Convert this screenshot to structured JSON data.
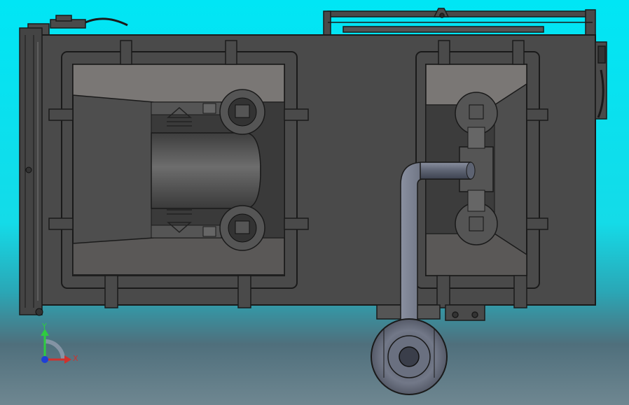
{
  "viewport": {
    "background_top": "#00e6f5",
    "background_bottom": "#6f8791",
    "model_color": "#4a4a4a",
    "panel_color": "#7a7775",
    "pipe_color": "#6c7282",
    "edge_color": "#1a1a1a"
  },
  "triad": {
    "y_label": "Y",
    "x_label": "X",
    "y_color": "#2ecc40",
    "x_color": "#d0312d",
    "z_color": "#1e3fd6"
  }
}
